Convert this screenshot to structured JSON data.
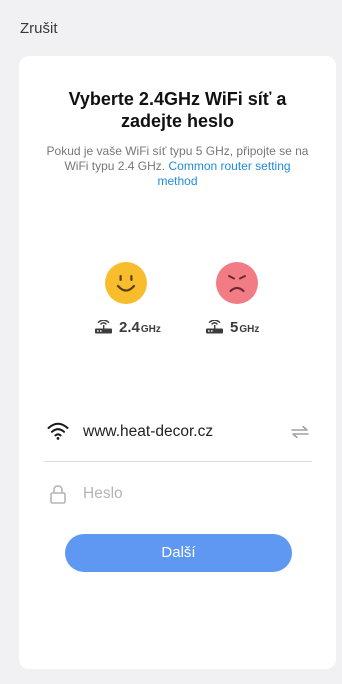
{
  "header": {
    "cancel_label": "Zrušit"
  },
  "card": {
    "title": "Vyberte 2.4GHz WiFi síť a zadejte heslo",
    "subtitle": "Pokud je vaše WiFi síť typu 5 GHz, připojte se na WiFi typu 2.4 GHz.",
    "subtitle_link": "Common router setting method"
  },
  "bands": [
    {
      "number": "2.4",
      "unit": "GHz",
      "status": "supported",
      "face": "happy-face-icon",
      "color": "#f8bd2d"
    },
    {
      "number": "5",
      "unit": "GHz",
      "status": "unsupported",
      "face": "sad-face-icon",
      "color": "#f27c86"
    }
  ],
  "wifi": {
    "ssid": "www.heat-decor.cz",
    "icon": "wifi-icon",
    "switch_icon": "swap-icon"
  },
  "password": {
    "value": "",
    "placeholder": "Heslo",
    "icon": "lock-icon"
  },
  "next_button": {
    "label": "Další",
    "color": "#5e98f2"
  },
  "colors": {
    "background": "#f1f1f4",
    "card": "#ffffff",
    "link": "#1f8be0"
  }
}
